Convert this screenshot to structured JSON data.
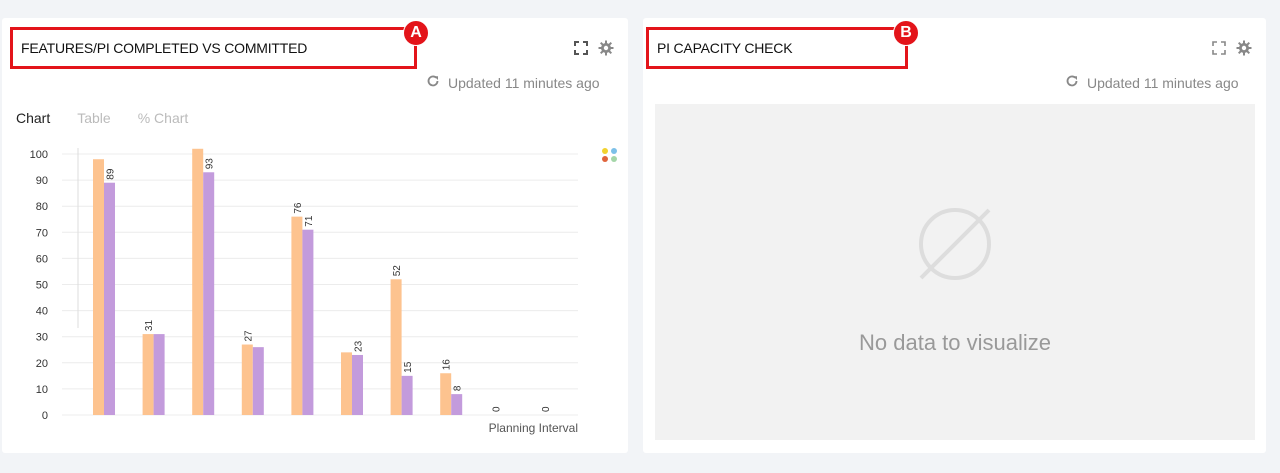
{
  "panel_a": {
    "title": "FEATURES/PI COMPLETED VS COMMITTED",
    "marker": "A",
    "icons": [
      "expand-icon",
      "gear-icon"
    ],
    "refresh_icon": "refresh-icon",
    "updated": "Updated 11 minutes ago",
    "tabs": [
      "Chart",
      "Table",
      "% Chart"
    ],
    "active_tab": "Chart",
    "legend_icon": "legend-dots-icon",
    "legend_colors": [
      "#f2d22e",
      "#7cc0e8",
      "#e0643c",
      "#a4d6a8"
    ]
  },
  "panel_b": {
    "title": "PI CAPACITY CHECK",
    "marker": "B",
    "icons": [
      "expand-icon",
      "gear-icon"
    ],
    "refresh_icon": "refresh-icon",
    "updated": "Updated 11 minutes ago",
    "empty_icon": "empty-set-icon",
    "empty_message": "No data to visualize"
  },
  "chart_data": {
    "type": "bar",
    "xlabel": "Planning Interval",
    "ylabel": "",
    "ylim": [
      0,
      100
    ],
    "yticks": [
      0,
      10,
      20,
      30,
      40,
      50,
      60,
      70,
      80,
      90,
      100
    ],
    "grid": true,
    "categories": [
      "",
      "",
      "",
      "",
      "",
      "",
      "",
      "",
      "",
      ""
    ],
    "series": [
      {
        "color": "#fdc38f",
        "values": [
          98,
          31,
          102,
          27,
          76,
          24,
          52,
          16,
          0,
          0
        ]
      },
      {
        "color": "#c39bdc",
        "values": [
          89,
          31,
          93,
          26,
          71,
          23,
          15,
          8,
          null,
          null
        ]
      }
    ],
    "data_labels": [
      "89",
      "31",
      "93",
      "27",
      "76",
      "71",
      "23",
      "52",
      "15",
      "16",
      "8",
      "0",
      "0"
    ]
  }
}
